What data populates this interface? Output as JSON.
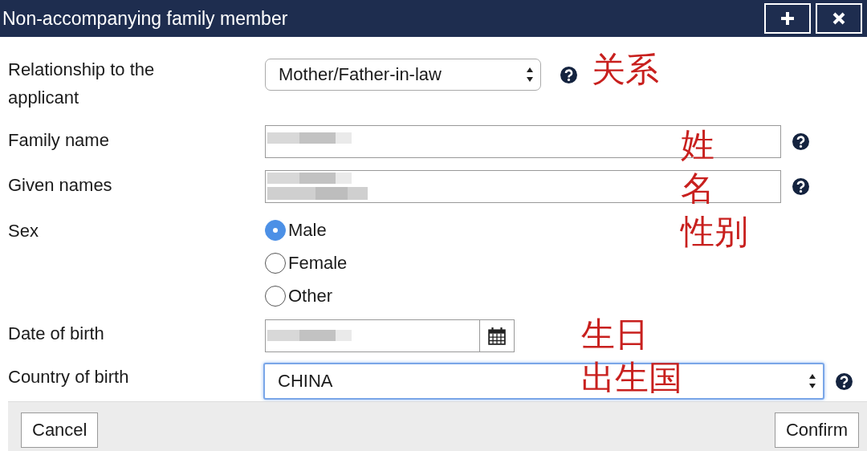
{
  "window": {
    "title": "Non-accompanying family member"
  },
  "title_buttons": [
    {
      "kind": "add"
    },
    {
      "kind": "close"
    }
  ],
  "fields": [
    {
      "kind": "select",
      "label": "Relationship to the applicant",
      "value": "Mother/Father-in-law",
      "help": true,
      "focused": false
    },
    {
      "kind": "text",
      "label": "Family name",
      "redacted": true,
      "help": true
    },
    {
      "kind": "text",
      "label": "Given names",
      "redacted": true,
      "help": true
    },
    {
      "kind": "radio",
      "label": "Sex",
      "options": [
        {
          "label": "Male",
          "selected": true
        },
        {
          "label": "Female",
          "selected": false
        },
        {
          "label": "Other",
          "selected": false
        }
      ]
    },
    {
      "kind": "date",
      "label": "Date of birth",
      "redacted": true,
      "help": false
    },
    {
      "kind": "select",
      "label": "Country of birth",
      "value": "CHINA",
      "help": true,
      "focused": true
    }
  ],
  "annotations": [
    "关系",
    "姓",
    "名",
    "性别",
    "生日",
    "出生国"
  ],
  "buttons": [
    {
      "label": "Cancel"
    },
    {
      "label": "Confirm"
    }
  ]
}
